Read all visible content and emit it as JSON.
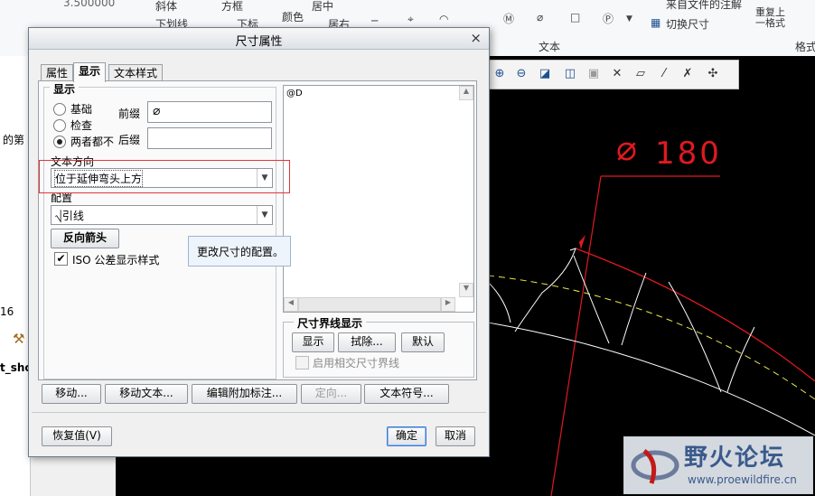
{
  "ribbon": {
    "items": [
      "斜体",
      "方框",
      "居中",
      "来自文件的注解",
      "下划线",
      "下标",
      "颜色",
      "居右",
      "切换尺寸",
      "重复上一格式"
    ],
    "section_label": "文本",
    "format_label": "格式",
    "font_size_value": "3.500000"
  },
  "left_strip": {
    "label_partial_1": "的第",
    "label_partial_2": "16",
    "label_partial_3": "t_sho"
  },
  "dialog": {
    "title": "尺寸属性",
    "close_glyph": "×",
    "tabs": [
      "属性",
      "显示",
      "文本样式"
    ],
    "display_group": {
      "title": "显示",
      "radios": [
        {
          "label": "基础",
          "selected": false
        },
        {
          "label": "检查",
          "selected": false
        },
        {
          "label": "两者都不",
          "selected": true
        }
      ],
      "prefix_label": "前缀",
      "prefix_value": "⌀",
      "suffix_label": "后缀",
      "suffix_value": ""
    },
    "text_direction": {
      "label": "文本方向",
      "value": "位于延伸弯头上方"
    },
    "config": {
      "label": "配置",
      "value": "引线"
    },
    "reverse_arrow_button": "反向箭头",
    "iso_checkbox": {
      "label": "ISO 公差显示样式",
      "checked": true,
      "check_glyph": "✔"
    },
    "text_content": "@D",
    "witness_group": {
      "title": "尺寸界线显示",
      "show_button": "显示",
      "erase_button": "拭除...",
      "default_button": "默认",
      "intersect_checkbox": "启用相交尺寸界线"
    },
    "bottom_buttons": [
      "移动...",
      "移动文本...",
      "编辑附加标注...",
      "定向...",
      "文本符号..."
    ],
    "restore_button": "恢复值(V)",
    "ok_button": "确定",
    "cancel_button": "取消"
  },
  "tooltip": "更改尺寸的配置。",
  "drawing": {
    "dimension_text": "180",
    "dimension_symbol": "⌀"
  },
  "watermark": {
    "title": "野火论坛",
    "url": "www.proewildfire.cn"
  },
  "colors": {
    "highlight": "#e0363a",
    "dim_red": "#e0191f",
    "gear_white": "#ffffff",
    "pitch_yellow": "#e8e84a",
    "canvas": "#000000"
  }
}
